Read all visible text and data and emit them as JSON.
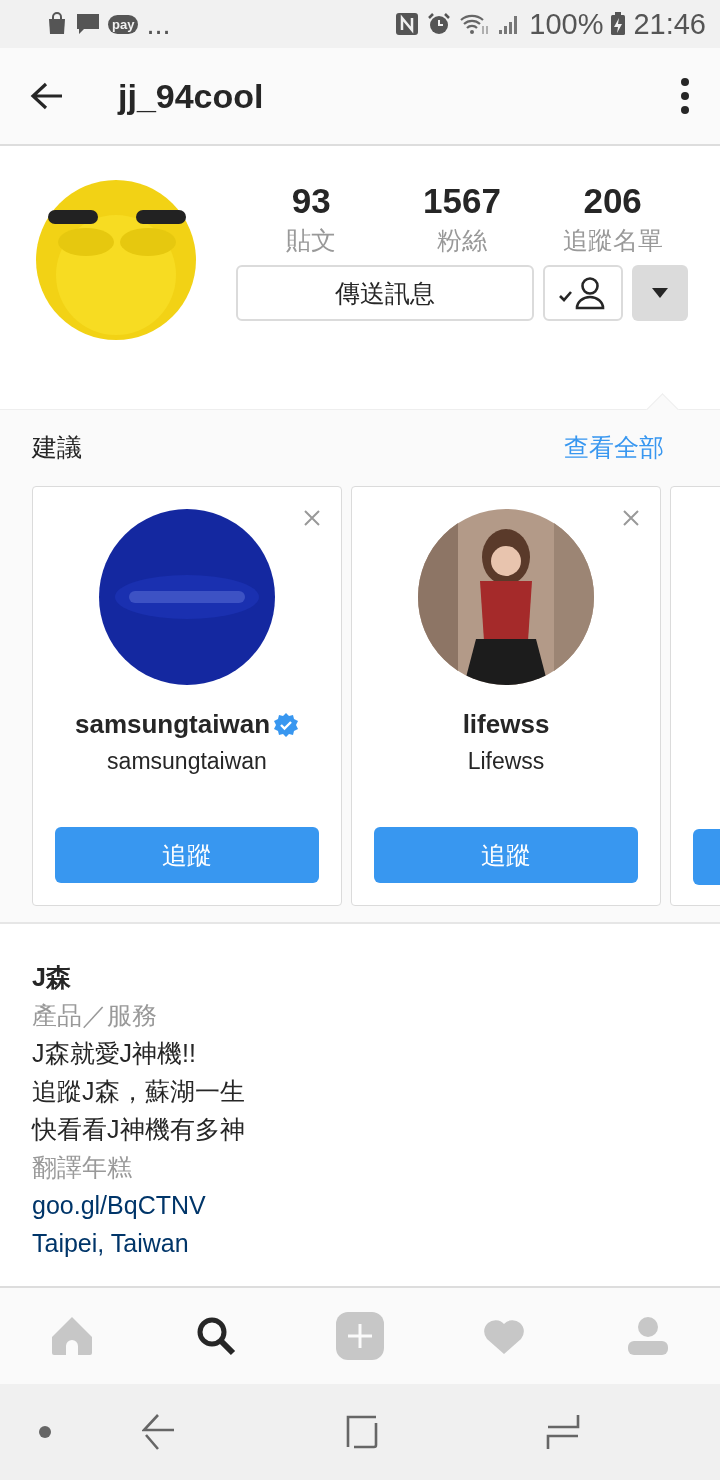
{
  "status_bar": {
    "pay_label": "pay",
    "more": "...",
    "battery": "100%",
    "time": "21:46"
  },
  "app_bar": {
    "title": "jj_94cool"
  },
  "profile": {
    "stats": [
      {
        "value": "93",
        "label": "貼文"
      },
      {
        "value": "1567",
        "label": "粉絲"
      },
      {
        "value": "206",
        "label": "追蹤名單"
      }
    ],
    "message_button": "傳送訊息",
    "following": true,
    "suggestions_expanded": true
  },
  "suggestions": {
    "title": "建議",
    "see_all": "查看全部",
    "cards": [
      {
        "kind": "brand",
        "username": "samsungtaiwan",
        "verified": true,
        "name": "samsungtaiwan",
        "follow": "追蹤"
      },
      {
        "kind": "person",
        "username": "lifewss",
        "verified": false,
        "name": "Lifewss",
        "follow": "追蹤"
      },
      {
        "kind": "partial"
      }
    ]
  },
  "bio": {
    "name": "J森",
    "category": "產品／服務",
    "lines": [
      "J森就愛J神機!!",
      "追蹤J森，蘇湖一生",
      "快看看J神機有多神"
    ],
    "translate": "翻譯年糕",
    "link": "goo.gl/BqCTNV",
    "location": "Taipei, Taiwan"
  },
  "tab_bar": [
    {
      "kind": "home",
      "selected": false
    },
    {
      "kind": "search",
      "selected": true
    },
    {
      "kind": "add",
      "selected": false
    },
    {
      "kind": "activity",
      "selected": false
    },
    {
      "kind": "profile",
      "selected": false
    }
  ]
}
